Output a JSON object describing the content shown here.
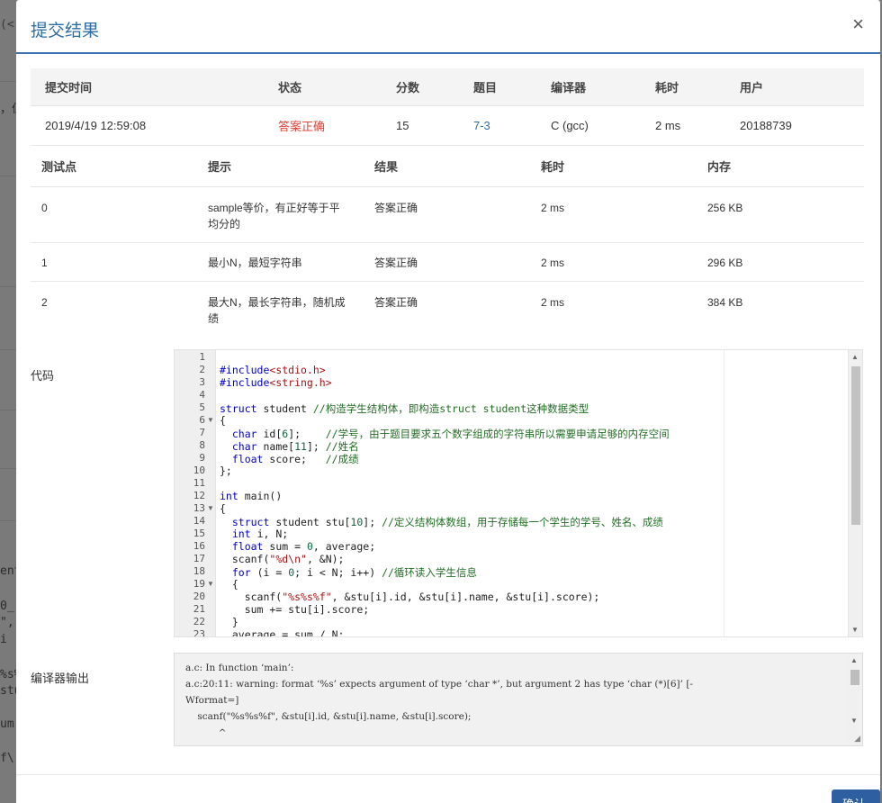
{
  "modal": {
    "title": "提交结果",
    "close": "×"
  },
  "summary": {
    "headers": [
      "提交时间",
      "状态",
      "分数",
      "题目",
      "编译器",
      "耗时",
      "用户"
    ],
    "row": {
      "time": "2019/4/19 12:59:08",
      "status": "答案正确",
      "score": "15",
      "problem": "7-3",
      "compiler": "C (gcc)",
      "elapsed": "2 ms",
      "user": "20188739"
    }
  },
  "tests": {
    "headers": [
      "测试点",
      "提示",
      "结果",
      "耗时",
      "内存"
    ],
    "rows": [
      {
        "id": "0",
        "hint_line1": "sample等价，有正好等于平",
        "hint_line2": "均分的",
        "result": "答案正确",
        "time": "2 ms",
        "memory": "256 KB"
      },
      {
        "id": "1",
        "hint_line1": "最小N，最短字符串",
        "hint_line2": "",
        "result": "答案正确",
        "time": "2 ms",
        "memory": "296 KB"
      },
      {
        "id": "2",
        "hint_line1": "最大N，最长字符串，随机成",
        "hint_line2": "绩",
        "result": "答案正确",
        "time": "2 ms",
        "memory": "384 KB"
      }
    ]
  },
  "code_label": "代码",
  "compiler_label": "编译器输出",
  "code_lines": [
    "",
    "#include<stdio.h>",
    "#include<string.h>",
    "",
    "struct student //构造学生结构体，即构造struct student这种数据类型",
    "{",
    "  char id[6];    //学号，由于题目要求五个数字组成的字符串所以需要申请足够的内存空间",
    "  char name[11]; //姓名",
    "  float score;   //成绩",
    "};",
    "",
    "int main()",
    "{",
    "  struct student stu[10]; //定义结构体数组，用于存储每一个学生的学号、姓名、成绩",
    "  int i, N;",
    "  float sum = 0, average;",
    "  scanf(\"%d\\n\", &N);",
    "  for (i = 0; i < N; i++) //循环读入学生信息",
    "  {",
    "    scanf(\"%s%s%f\", &stu[i].id, &stu[i].name, &stu[i].score);",
    "    sum += stu[i].score;",
    "  }",
    "  average = sum / N;"
  ],
  "compiler_output": [
    "a.c: In function ‘main’:",
    "a.c:20:11: warning: format ‘%s’ expects argument of type ‘char *’, but argument 2 has type ‘char (*)[6]’ [-",
    "Wformat=]",
    "    scanf(\"%s%s%f\", &stu[i].id, &stu[i].name, &stu[i].score);",
    "           ^"
  ],
  "backdrop_fragments": [
    "(<",
    "，但",
    "ent",
    "0_",
    "\",",
    "i",
    "%s%",
    "stu",
    "um",
    "f\\"
  ],
  "footer": {
    "ok": "确认"
  },
  "colors": {
    "accent": "#2e6da4",
    "success": "#e0443a",
    "header_rule": "#3a6fb0"
  }
}
